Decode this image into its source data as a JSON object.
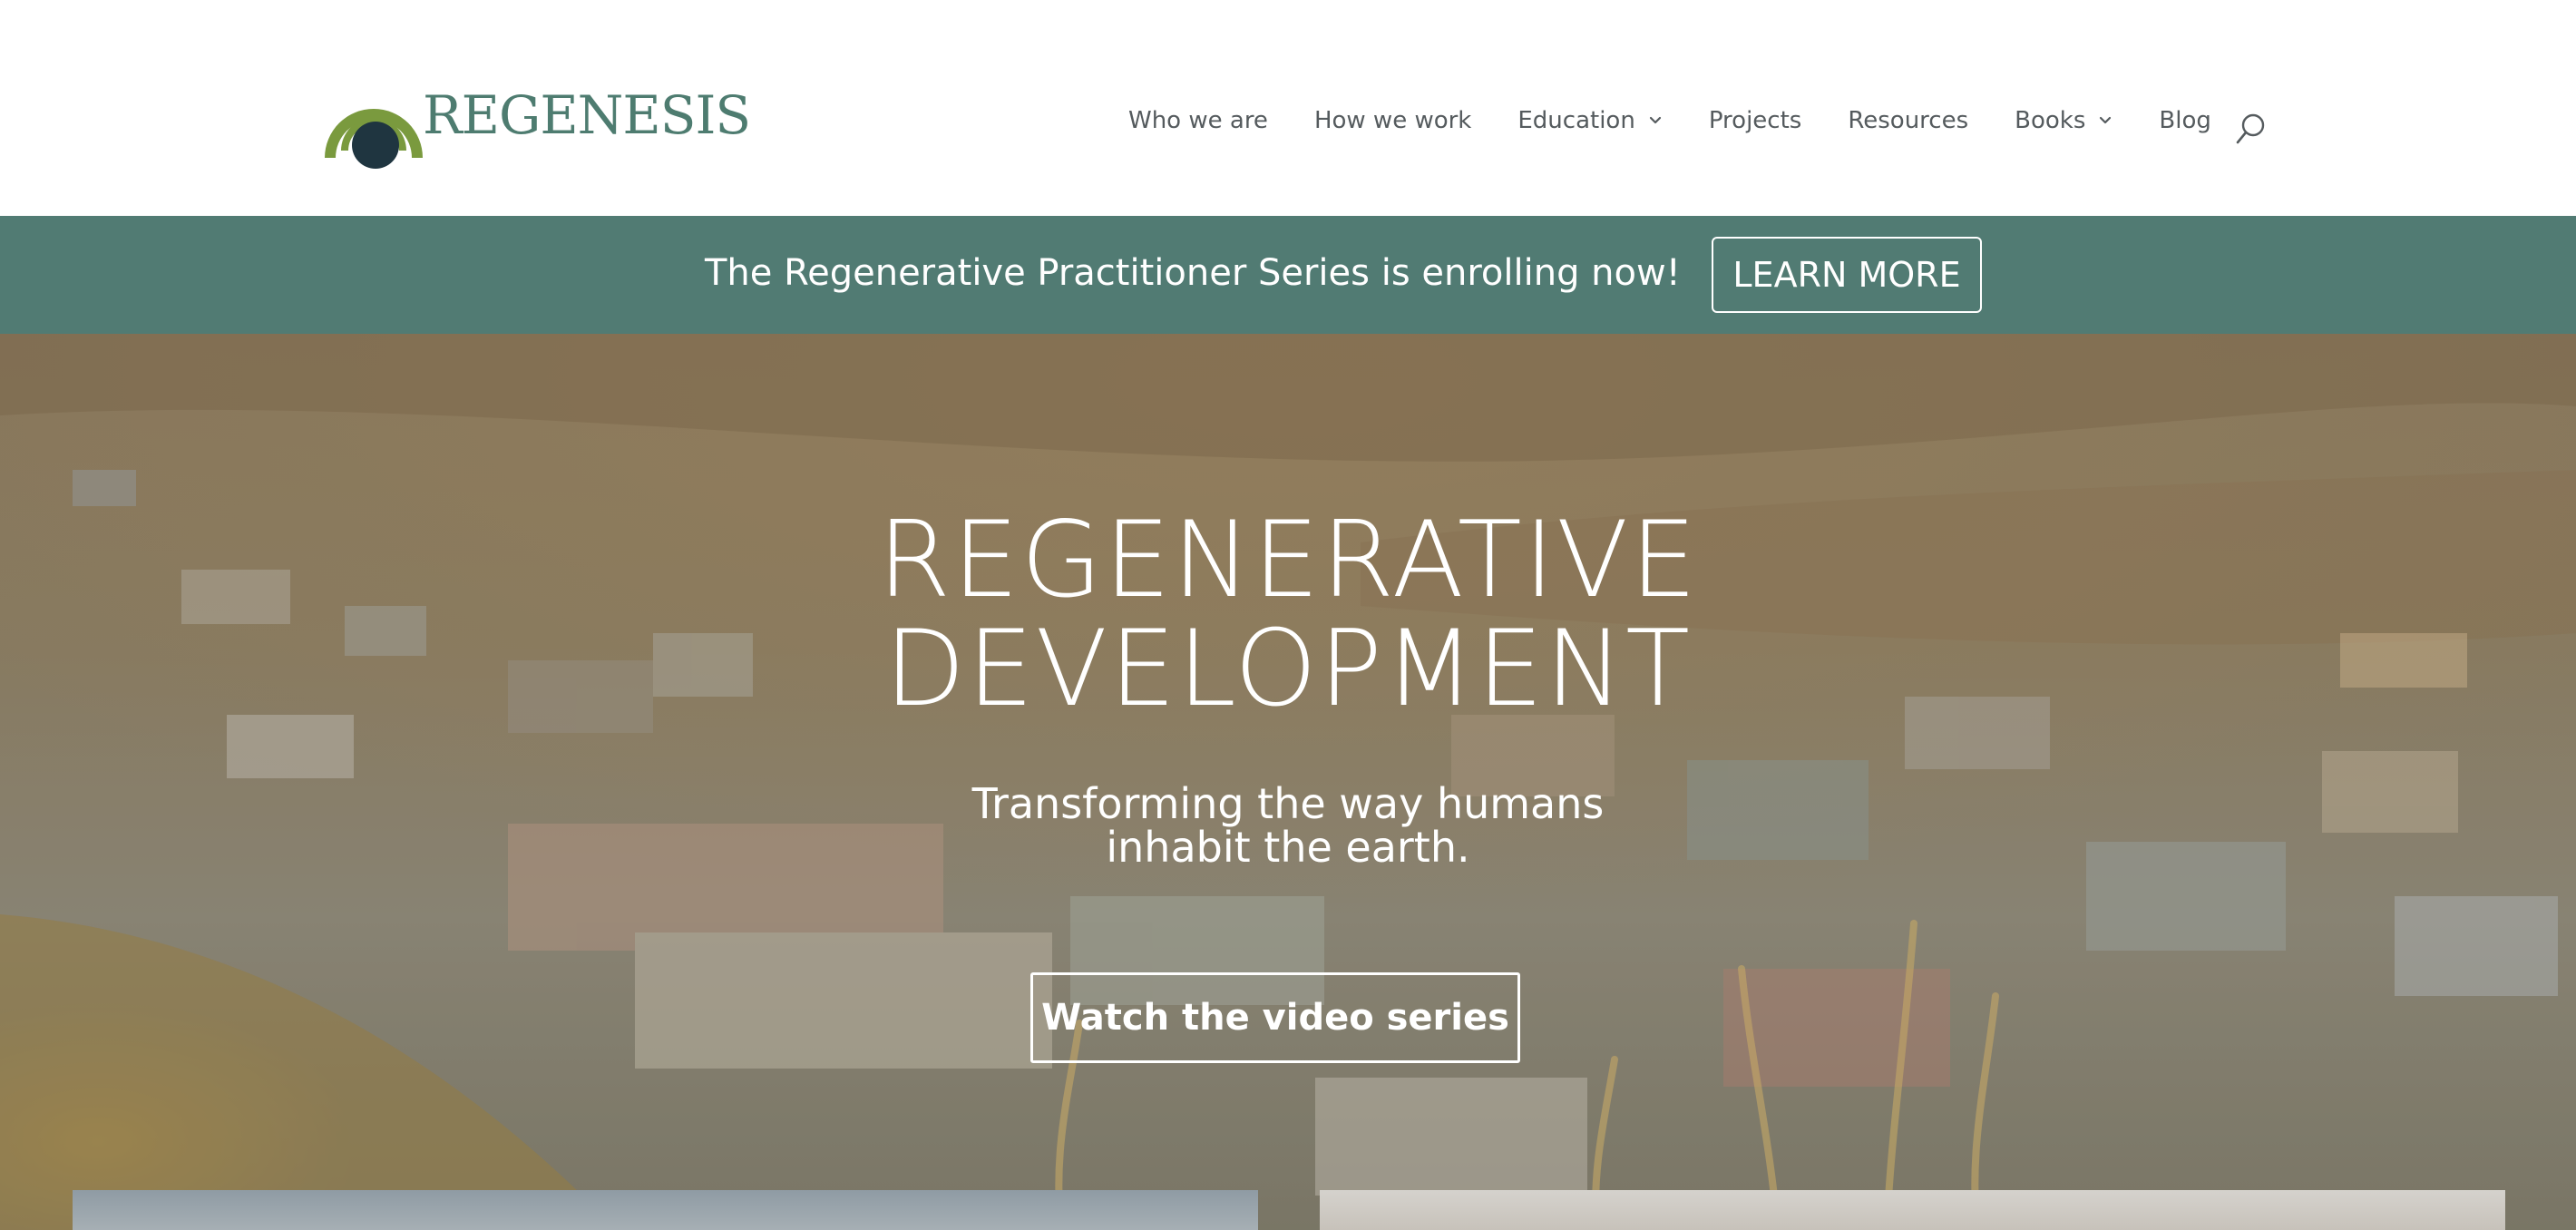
{
  "header": {
    "logo_text": "REGENESIS",
    "nav": [
      {
        "label": "Who we are",
        "has_dropdown": false
      },
      {
        "label": "How we work",
        "has_dropdown": false
      },
      {
        "label": "Education",
        "has_dropdown": true
      },
      {
        "label": "Projects",
        "has_dropdown": false
      },
      {
        "label": "Resources",
        "has_dropdown": false
      },
      {
        "label": "Books",
        "has_dropdown": true
      },
      {
        "label": "Blog",
        "has_dropdown": false
      }
    ],
    "search_icon": "search-icon"
  },
  "announcement": {
    "text": "The Regenerative Practitioner Series is enrolling now!",
    "button_label": "LEARN MORE"
  },
  "hero": {
    "title_line1": "REGENERATIVE",
    "title_line2": "DEVELOPMENT",
    "subtitle_line1": "Transforming the way humans",
    "subtitle_line2": "inhabit the earth.",
    "button_label": "Watch the video series"
  },
  "colors": {
    "brand_green": "#517b73",
    "logo_olive": "#7a9a3e",
    "logo_dark": "#1f3540",
    "nav_text": "#555b5e",
    "white": "#ffffff"
  }
}
